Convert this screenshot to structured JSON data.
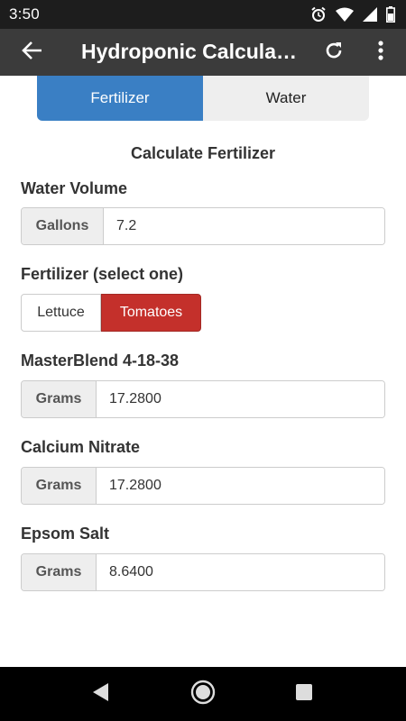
{
  "status_bar": {
    "time": "3:50",
    "icons": [
      "alarm-icon",
      "wifi-icon",
      "signal-icon",
      "battery-icon"
    ]
  },
  "app_bar": {
    "title": "Hydroponic Calcula…",
    "back_icon": "arrow-back-icon",
    "refresh_icon": "refresh-icon",
    "menu_icon": "more-vert-icon"
  },
  "tabs": {
    "items": [
      {
        "label": "Fertilizer",
        "active": true
      },
      {
        "label": "Water",
        "active": false
      }
    ],
    "active_color": "#3a7fc4"
  },
  "main": {
    "section_title": "Calculate Fertilizer",
    "water_volume": {
      "label": "Water Volume",
      "unit": "Gallons",
      "value": "7.2"
    },
    "fertilizer_select": {
      "label": "Fertilizer (select one)",
      "options": [
        {
          "label": "Lettuce",
          "selected": false
        },
        {
          "label": "Tomatoes",
          "selected": true
        }
      ],
      "selected_color": "#c4302b"
    },
    "masterblend": {
      "label": "MasterBlend 4-18-38",
      "unit": "Grams",
      "value": "17.2800"
    },
    "calcium_nitrate": {
      "label": "Calcium Nitrate",
      "unit": "Grams",
      "value": "17.2800"
    },
    "epsom_salt": {
      "label": "Epsom Salt",
      "unit": "Grams",
      "value": "8.6400"
    }
  },
  "nav_bar": {
    "buttons": [
      "back-triangle-icon",
      "home-circle-icon",
      "recents-square-icon"
    ]
  }
}
